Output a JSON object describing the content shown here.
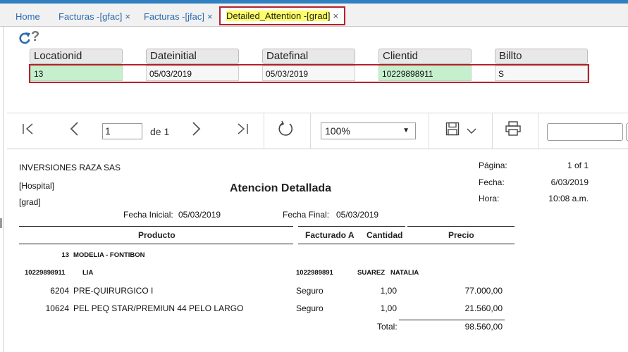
{
  "tabs": [
    {
      "label": "Home",
      "closable": false
    },
    {
      "label": "Facturas -[gfac]",
      "closable": true
    },
    {
      "label": "Facturas -[jfac]",
      "closable": true
    },
    {
      "label": "Detailed_Attention -[grad]",
      "closable": true,
      "active": true
    }
  ],
  "close_glyph": "×",
  "help_glyph": "?",
  "params": {
    "labels": [
      "Locationid",
      "Dateinitial",
      "Datefinal",
      "Clientid",
      "Billto"
    ],
    "values": [
      "13",
      "05/03/2019",
      "05/03/2019",
      "10229898911",
      "S"
    ]
  },
  "toolbar": {
    "page_value": "1",
    "of_label": "de 1",
    "zoom": "100%",
    "zoom_arrow": "▼"
  },
  "report": {
    "company": "INVERSIONES RAZA SAS",
    "line2": "[Hospital]",
    "line3": "[grad]",
    "title": "Atencion Detallada",
    "page_label": "Página:",
    "page_value": "1 of 1",
    "date_label": "Fecha:",
    "date_value": "6/03/2019",
    "time_label": "Hora:",
    "time_value": "10:08 a.m.",
    "fecha_inicial_label": "Fecha Inicial:",
    "fecha_inicial_value": "05/03/2019",
    "fecha_final_label": "Fecha Final:",
    "fecha_final_value": "05/03/2019",
    "columns": {
      "producto": "Producto",
      "facturado": "Facturado A",
      "cantidad": "Cantidad",
      "precio": "Precio"
    },
    "location_code": "13",
    "location_name": "MODELIA - FONTIBON",
    "client_id": "10229898911",
    "client_name": "LIA",
    "billed_id": "1022989891",
    "billed_name": "SUAREZ   NATALIA",
    "rows": [
      {
        "code": "6204",
        "desc": "PRE-QUIRURGICO I",
        "facturado": "Seguro",
        "cantidad": "1,00",
        "precio": "77.000,00"
      },
      {
        "code": "10624",
        "desc": "PEL PEQ STAR/PREMIUN 44 PELO LARGO",
        "facturado": "Seguro",
        "cantidad": "1,00",
        "precio": "21.560,00"
      }
    ],
    "total_label": "Total:",
    "total_value": "98.560,00"
  }
}
